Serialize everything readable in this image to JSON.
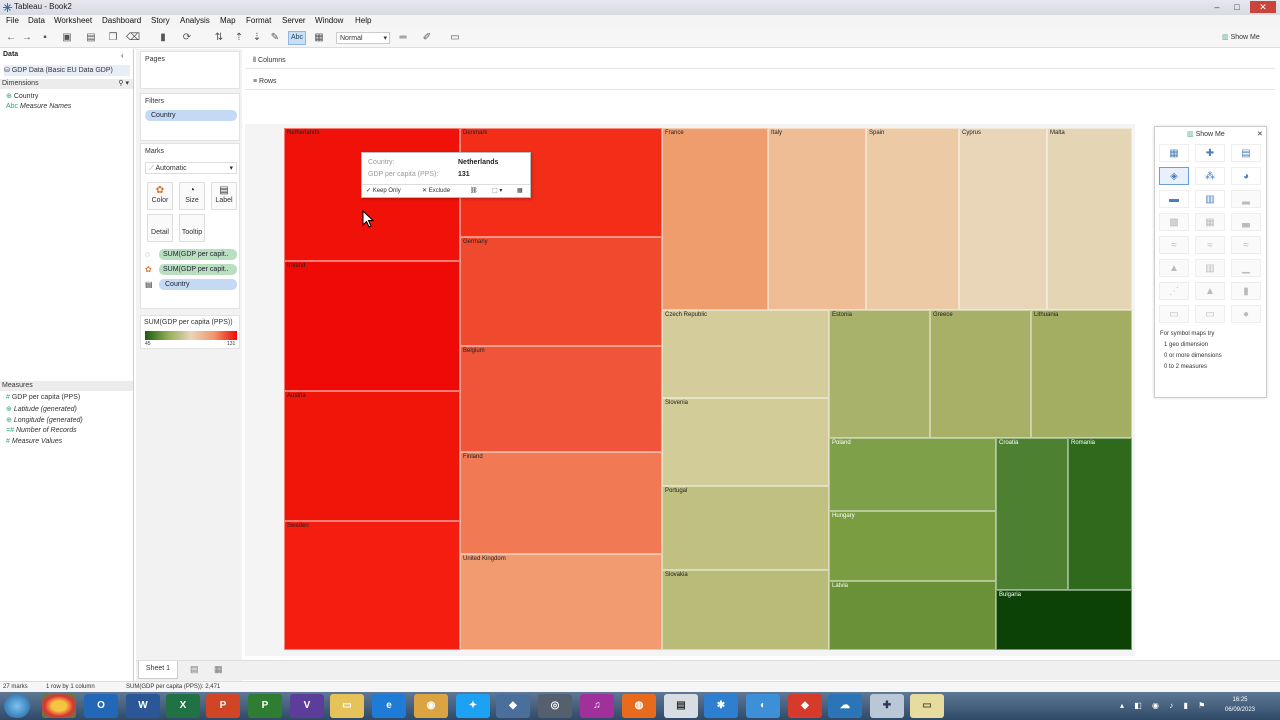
{
  "window": {
    "title": "Tableau - Book2",
    "minimize": "–",
    "maximize": "□",
    "close": "✕"
  },
  "menu": [
    "File",
    "Data",
    "Worksheet",
    "Dashboard",
    "Story",
    "Analysis",
    "Map",
    "Format",
    "Server",
    "Window",
    "Help"
  ],
  "toolbar": {
    "fit": "Normal",
    "abc": "Abc",
    "show_me": "Show Me"
  },
  "data_pane": {
    "header": "Data",
    "source": "GDP Data (Basic EU Data GDP)",
    "dimensions_label": "Dimensions",
    "dimensions": [
      "Country",
      "Measure Names"
    ],
    "measures_label": "Measures",
    "measures": [
      "GDP per capita (PPS)",
      "Latitude (generated)",
      "Longitude (generated)",
      "Number of Records",
      "Measure Values"
    ]
  },
  "shelves": {
    "pages": "Pages",
    "filters": "Filters",
    "filter_pill": "Country",
    "marks": "Marks",
    "mark_type": "Automatic",
    "mark_buttons": [
      "Color",
      "Size",
      "Label",
      "Detail",
      "Tooltip"
    ],
    "mark_pills": [
      "SUM(GDP per capit..",
      "SUM(GDP per capit..",
      "Country"
    ],
    "legend_title": "SUM(GDP per capita (PPS))",
    "legend_min": "45",
    "legend_max": "131",
    "columns": "Columns",
    "rows": "Rows"
  },
  "treemap": {
    "tiles": [
      {
        "name": "Netherlands",
        "color": "#f01208"
      },
      {
        "name": "Ireland",
        "color": "#f00a05"
      },
      {
        "name": "Austria",
        "color": "#f01409"
      },
      {
        "name": "Sweden",
        "color": "#f51c10"
      },
      {
        "name": "Denmark",
        "color": "#f42d19"
      },
      {
        "name": "Germany",
        "color": "#f04a2e"
      },
      {
        "name": "Belgium",
        "color": "#f0553a"
      },
      {
        "name": "Finland",
        "color": "#f17a55"
      },
      {
        "name": "United Kingdom",
        "color": "#f29a70"
      },
      {
        "name": "France",
        "color": "#ef9d6d"
      },
      {
        "name": "Italy",
        "color": "#eebd95"
      },
      {
        "name": "Spain",
        "color": "#eccaa5"
      },
      {
        "name": "Cyprus",
        "color": "#e9d6b8"
      },
      {
        "name": "Malta",
        "color": "#e4d6b4"
      },
      {
        "name": "Czech Republic",
        "color": "#d5cc9c"
      },
      {
        "name": "Slovenia",
        "color": "#d1cc98"
      },
      {
        "name": "Portugal",
        "color": "#c0c080"
      },
      {
        "name": "Slovakia",
        "color": "#b8bc78"
      },
      {
        "name": "Estonia",
        "color": "#a9b26a"
      },
      {
        "name": "Greece",
        "color": "#a8b068"
      },
      {
        "name": "Lithuania",
        "color": "#a3ae62"
      },
      {
        "name": "Poland",
        "color": "#7ea048"
      },
      {
        "name": "Hungary",
        "color": "#7a9d42"
      },
      {
        "name": "Latvia",
        "color": "#6a9138"
      },
      {
        "name": "Croatia",
        "color": "#4d8030"
      },
      {
        "name": "Romania",
        "color": "#2f6a1c"
      },
      {
        "name": "Bulgaria",
        "color": "#0d4206"
      }
    ]
  },
  "tooltip": {
    "country_label": "Country:",
    "country_value": "Netherlands",
    "gdp_label": "GDP per capita (PPS):",
    "gdp_value": "131",
    "keep_only": "Keep Only",
    "exclude": "Exclude"
  },
  "show_me": {
    "title": "Show Me",
    "hint_line1": "For symbol maps try",
    "hint_line2": "1 geo dimension",
    "hint_line3": "0 or more dimensions",
    "hint_line4": "0 to 2 measures"
  },
  "sheet_tab": "Sheet 1",
  "status": {
    "marks": "27 marks",
    "rows_cols": "1 row by 1 column",
    "sum": "SUM(GDP per capita (PPS)): 2,471"
  },
  "clock": {
    "time": "16:25",
    "date": "06/09/2023"
  }
}
